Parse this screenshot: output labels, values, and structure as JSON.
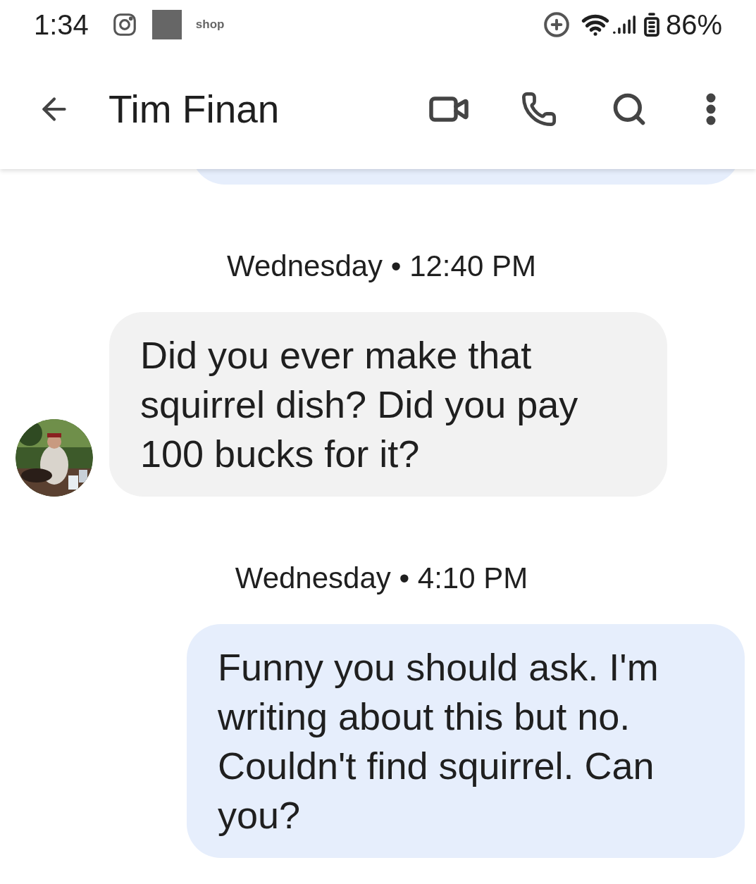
{
  "status_bar": {
    "time": "1:34",
    "notification_text": "shop",
    "battery": "86%"
  },
  "header": {
    "title": "Tim Finan"
  },
  "messages": [
    {
      "kind": "covered"
    },
    {
      "kind": "timestamp",
      "text": "Wednesday • 12:40 PM"
    },
    {
      "kind": "incoming",
      "lines": [
        "Did you ever make that",
        "squirrel dish? Did you pay",
        "100 bucks for it?"
      ]
    },
    {
      "kind": "timestamp",
      "text": "Wednesday • 4:10 PM"
    },
    {
      "kind": "outgoing",
      "lines": [
        "Funny you should ask. I'm",
        "writing about this but no.",
        "Couldn't find squirrel. Can",
        "you?"
      ]
    }
  ]
}
